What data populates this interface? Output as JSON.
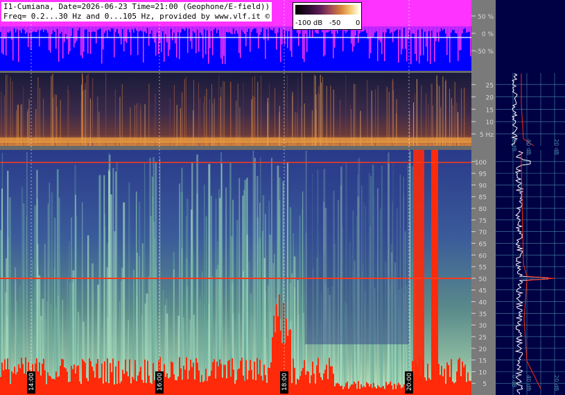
{
  "header": {
    "line1": "I1-Cumiana, Date=2026-06-23 Time=21:00 (Geophone/E-field))",
    "line2": "Freq= 0.2...30 Hz and 0...105 Hz, provided by www.vlf.it ©"
  },
  "colorbar": {
    "labels": [
      "-100 dB",
      "-50",
      "0"
    ]
  },
  "colors": {
    "magenta": "#ff33ff",
    "blue": "#0000ff",
    "red_line": "#ff2a0a",
    "axis_text": "#d8d8d8",
    "right_panel_bg": "#000044",
    "right_grid": "#4a8aa8"
  },
  "chart_data": [
    {
      "type": "area",
      "title": "",
      "y_ticks": [
        "50 %",
        "0 %",
        "-50 %"
      ],
      "y_values": [
        50,
        0,
        -50
      ]
    },
    {
      "type": "heatmap",
      "title": "",
      "y_unit": "Hz",
      "y_ticks": [
        "25",
        "20",
        "15",
        "10",
        "5 Hz"
      ],
      "y_values": [
        25,
        20,
        15,
        10,
        5
      ],
      "ylim": [
        0.2,
        30
      ]
    },
    {
      "type": "heatmap",
      "title": "",
      "y_ticks": [
        "100",
        "95",
        "90",
        "85",
        "80",
        "75",
        "70",
        "65",
        "60",
        "55",
        "50",
        "45",
        "40",
        "35",
        "30",
        "25",
        "20",
        "15",
        "10",
        "5"
      ],
      "y_values": [
        100,
        95,
        90,
        85,
        80,
        75,
        70,
        65,
        60,
        55,
        50,
        45,
        40,
        35,
        30,
        25,
        20,
        15,
        10,
        5
      ],
      "ylim": [
        0,
        105
      ],
      "x_ticks": [
        "14:00",
        "16:00",
        "18:00",
        "20:00"
      ],
      "x_values": [
        14,
        16,
        18,
        20
      ],
      "notable_lines_hz": [
        50,
        100
      ]
    }
  ],
  "right_panel": {
    "top_scale_labels": [
      "0 dB",
      "40 dB",
      "20 dB"
    ],
    "bottom_scale_labels": [
      "0 dB",
      "40 dB",
      "20 dB"
    ]
  }
}
